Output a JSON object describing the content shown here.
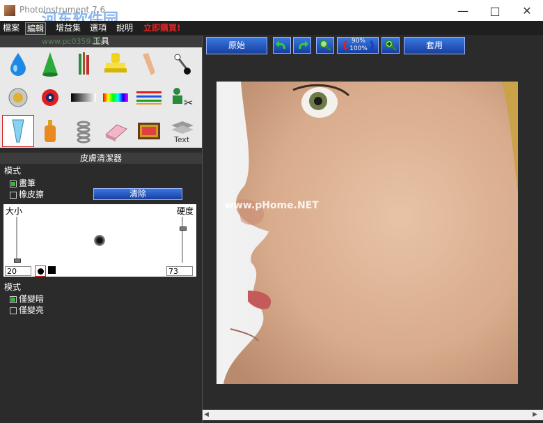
{
  "window": {
    "title": "PhotoInstrument 7.6",
    "watermark": "河东软件园"
  },
  "menu": {
    "items": [
      "檔案",
      "編輯",
      "增益集",
      "選項",
      "說明"
    ],
    "selected_index": 1,
    "promo": "立即購買!"
  },
  "tools_panel": {
    "title": "工具",
    "url_watermark": "www.pc0359.cn"
  },
  "brush_panel": {
    "title": "皮膚清潔器",
    "mode_label": "模式",
    "modes": [
      {
        "label": "畫筆",
        "selected": true
      },
      {
        "label": "橡皮擦",
        "selected": false
      }
    ],
    "clear_button": "清除",
    "size_label": "大小",
    "hardness_label": "硬度",
    "size_value": "20",
    "hardness_value": "73",
    "mode2_label": "模式",
    "modes2": [
      {
        "label": "僅變暗",
        "selected": true
      },
      {
        "label": "僅變亮",
        "selected": false
      }
    ]
  },
  "toolbar": {
    "original_button": "原始",
    "zoom_top": "90%",
    "zoom_bottom": "100%",
    "apply_button": "套用"
  },
  "image": {
    "watermark": "www.pHome.NET"
  },
  "colors": {
    "accent_blue": "#1f55c8",
    "menu_promo": "#e62020",
    "panel_bg": "#2b2b2b"
  }
}
